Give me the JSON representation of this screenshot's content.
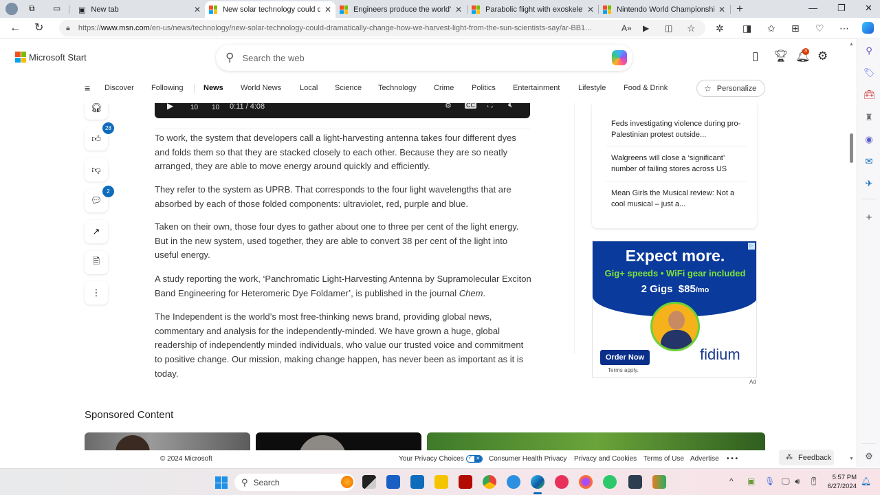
{
  "browser": {
    "tabs": [
      {
        "title": "New tab",
        "active": false
      },
      {
        "title": "New solar technology could dramatically",
        "active": true
      },
      {
        "title": "Engineers produce the world's first",
        "active": false
      },
      {
        "title": "Parabolic flight with exoskeleton:",
        "active": false
      },
      {
        "title": "Nintendo World Championships:",
        "active": false
      }
    ],
    "new_tab_label": "+",
    "window_controls": {
      "minimize": "—",
      "restore": "❐",
      "close": "✕"
    },
    "url_prefix": "https://",
    "url_domain": "www.msn.com",
    "url_path": "/en-us/news/technology/new-solar-technology-could-dramatically-change-how-we-harvest-light-from-the-sun-scientists-say/ar-BB1...",
    "toolbar_icons": [
      "read-aloud-icon",
      "immersive-reader-icon",
      "split-screen-icon",
      "favorite-star-icon",
      "extensions-icon",
      "split-window-icon",
      "favorites-icon",
      "collections-icon",
      "browser-essentials-icon",
      "more-icon",
      "copilot-icon"
    ]
  },
  "header": {
    "brand": "Microsoft Start",
    "search_placeholder": "Search the web",
    "notification_count": "3"
  },
  "nav": {
    "items": [
      "Discover",
      "Following",
      "News",
      "World News",
      "Local",
      "Science",
      "Technology",
      "Crime",
      "Politics",
      "Entertainment",
      "Lifestyle",
      "Food & Drink"
    ],
    "active": "News",
    "personalize_label": "Personalize"
  },
  "video": {
    "skip_back": "10",
    "skip_forward": "10",
    "time": "0:11 / 4:08"
  },
  "actions": {
    "likes": "28",
    "comments": "2"
  },
  "article": {
    "paragraphs": [
      "To work, the system that developers call a light-harvesting antenna takes four different dyes and folds them so that they are stacked closely to each other. Because they are so neatly arranged, they are able to move energy around quickly and efficiently.",
      "They refer to the system as UPRB. That corresponds to the four light wavelengths that are absorbed by each of those folded components: ultraviolet, red, purple and blue.",
      "Taken on their own, those four dyes to gather about one to three per cent of the light energy. But in the new system, used together, they are able to convert 38 per cent of the light into useful energy.",
      "The Independent is the world’s most free-thinking news brand, providing global news, commentary and analysis for the independently-minded. We have grown a huge, global readership of independently minded individuals, who value our trusted voice and commitment to positive change. Our mission, making change happen, has never been as important as it is today."
    ],
    "study_paragraph_prefix": "A study reporting the work, ‘Panchromatic Light-Harvesting Antenna by Supramolecular Exciton Band Engineering for Heteromeric Dye Foldamer’, is published in the journal ",
    "study_journal": "Chem",
    "study_suffix": "."
  },
  "trending": [
    "Feds investigating violence during pro-Palestinian protest outside...",
    "Walgreens will close a ‘significant’ number of failing stores across US",
    "Mean Girls the Musical review: Not a cool musical – just a..."
  ],
  "ad": {
    "headline": "Expect more.",
    "subline": "Gig+ speeds  •  WiFi gear included",
    "offer_speed": "2 Gigs",
    "offer_price": "$85",
    "offer_unit": "/mo",
    "cta": "Order Now",
    "terms": "Terms apply.",
    "brand": "fidium",
    "label": "Ad",
    "colors": {
      "background": "#0a3a9c",
      "accent": "#7fe23a"
    }
  },
  "sponsored": {
    "title": "Sponsored Content"
  },
  "footer": {
    "copyright": "© 2024 Microsoft",
    "links": [
      "Your Privacy Choices",
      "Consumer Health Privacy",
      "Privacy and Cookies",
      "Terms of Use",
      "Advertise"
    ],
    "more": "• • •",
    "feedback": "Feedback"
  },
  "taskbar": {
    "search_label": "Search",
    "time": "5:57 PM",
    "date": "6/27/2024"
  }
}
